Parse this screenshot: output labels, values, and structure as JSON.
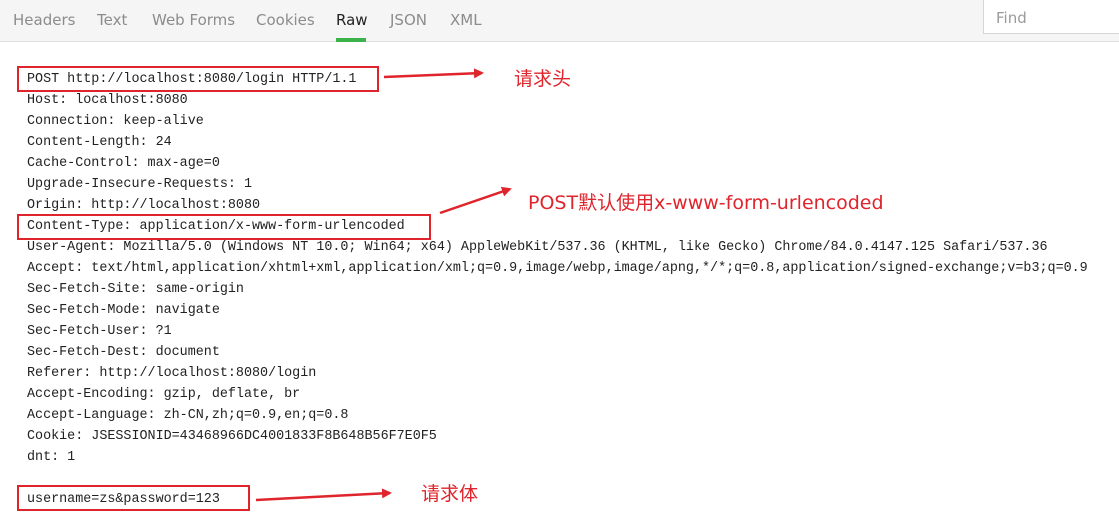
{
  "tabs": [
    "Headers",
    "Text",
    "Web Forms",
    "Cookies",
    "Raw",
    "JSON",
    "XML"
  ],
  "active_tab": "Raw",
  "find": {
    "placeholder": "Find"
  },
  "raw_lines": [
    "POST http://localhost:8080/login HTTP/1.1",
    "Host: localhost:8080",
    "Connection: keep-alive",
    "Content-Length: 24",
    "Cache-Control: max-age=0",
    "Upgrade-Insecure-Requests: 1",
    "Origin: http://localhost:8080",
    "Content-Type: application/x-www-form-urlencoded",
    "User-Agent: Mozilla/5.0 (Windows NT 10.0; Win64; x64) AppleWebKit/537.36 (KHTML, like Gecko) Chrome/84.0.4147.125 Safari/537.36",
    "Accept: text/html,application/xhtml+xml,application/xml;q=0.9,image/webp,image/apng,*/*;q=0.8,application/signed-exchange;v=b3;q=0.9",
    "Sec-Fetch-Site: same-origin",
    "Sec-Fetch-Mode: navigate",
    "Sec-Fetch-User: ?1",
    "Sec-Fetch-Dest: document",
    "Referer: http://localhost:8080/login",
    "Accept-Encoding: gzip, deflate, br",
    "Accept-Language: zh-CN,zh;q=0.9,en;q=0.8",
    "Cookie: JSESSIONID=43468966DC4001833F8B648B56F7E0F5",
    "dnt: 1",
    "",
    "username=zs&password=123"
  ],
  "annotations": {
    "request_header": "请求头",
    "content_type_note": "POST默认使用x-www-form-urlencoded",
    "request_body": "请求体"
  },
  "colors": {
    "annotation": "#e0242c",
    "active_tab_underline": "#3bb34a"
  }
}
